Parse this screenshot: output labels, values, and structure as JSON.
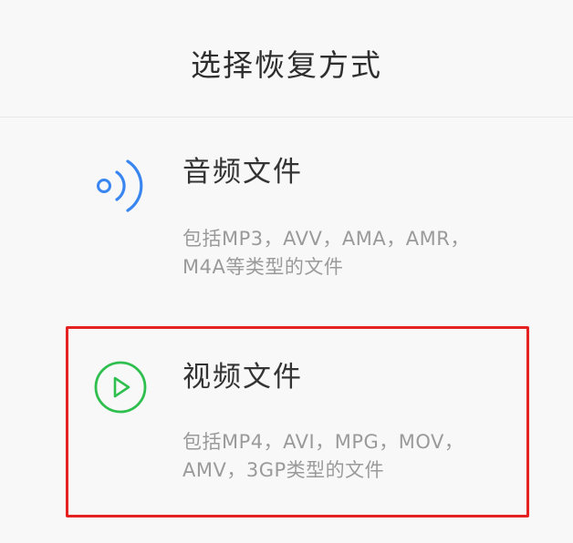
{
  "header": {
    "title": "选择恢复方式"
  },
  "options": [
    {
      "title": "音频文件",
      "desc_line1": "包括MP3，AVV，AMA，AMR，",
      "desc_line2": "M4A等类型的文件",
      "icon": "audio-waves-icon",
      "icon_color": "#3a86f0"
    },
    {
      "title": "视频文件",
      "desc_line1": "包括MP4，AVI，MPG，MOV，",
      "desc_line2": "AMV，3GP类型的文件",
      "icon": "play-circle-icon",
      "icon_color": "#2fbf4f",
      "selected": true
    }
  ],
  "colors": {
    "background": "#f8f8f8",
    "title": "#2e2e2e",
    "desc": "#9a9a9a",
    "highlight_border": "#e62121"
  }
}
